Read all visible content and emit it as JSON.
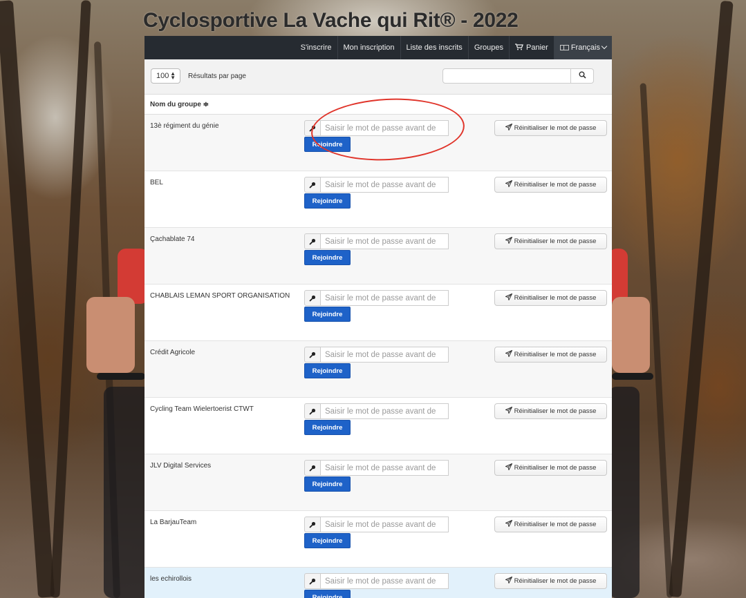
{
  "page": {
    "title": "Cyclosportive La Vache qui Rit® - 2022"
  },
  "nav": {
    "items": [
      {
        "label": "S'inscrire"
      },
      {
        "label": "Mon inscription"
      },
      {
        "label": "Liste des inscrits"
      },
      {
        "label": "Groupes"
      },
      {
        "label": "Panier",
        "icon": "cart-icon"
      },
      {
        "label": "Français",
        "icon": "flag-icon"
      }
    ]
  },
  "toolbar": {
    "per_page_value": "100",
    "per_page_label": "Résultats par page",
    "search_value": "",
    "search_icon": "search-icon"
  },
  "table": {
    "column_header": "Nom du groupe ≑",
    "password_placeholder": "Saisir le mot de passe avant de",
    "join_label": "Rejoindre",
    "reset_label": "Réinitialiser le mot de passe",
    "rows": [
      {
        "name": "13è régiment du génie"
      },
      {
        "name": "BEL"
      },
      {
        "name": "Çachablate 74"
      },
      {
        "name": "CHABLAIS LEMAN SPORT ORGANISATION"
      },
      {
        "name": "Crédit Agricole"
      },
      {
        "name": "Cycling Team Wielertoerist CTWT"
      },
      {
        "name": "JLV Digital Services"
      },
      {
        "name": "La BarjauTeam"
      },
      {
        "name": "les echirollois"
      }
    ]
  },
  "colors": {
    "navbar": "#262b31",
    "join_button": "#1e62c8",
    "annotation": "#e0342a",
    "highlight_row": "#e2f1fb"
  }
}
